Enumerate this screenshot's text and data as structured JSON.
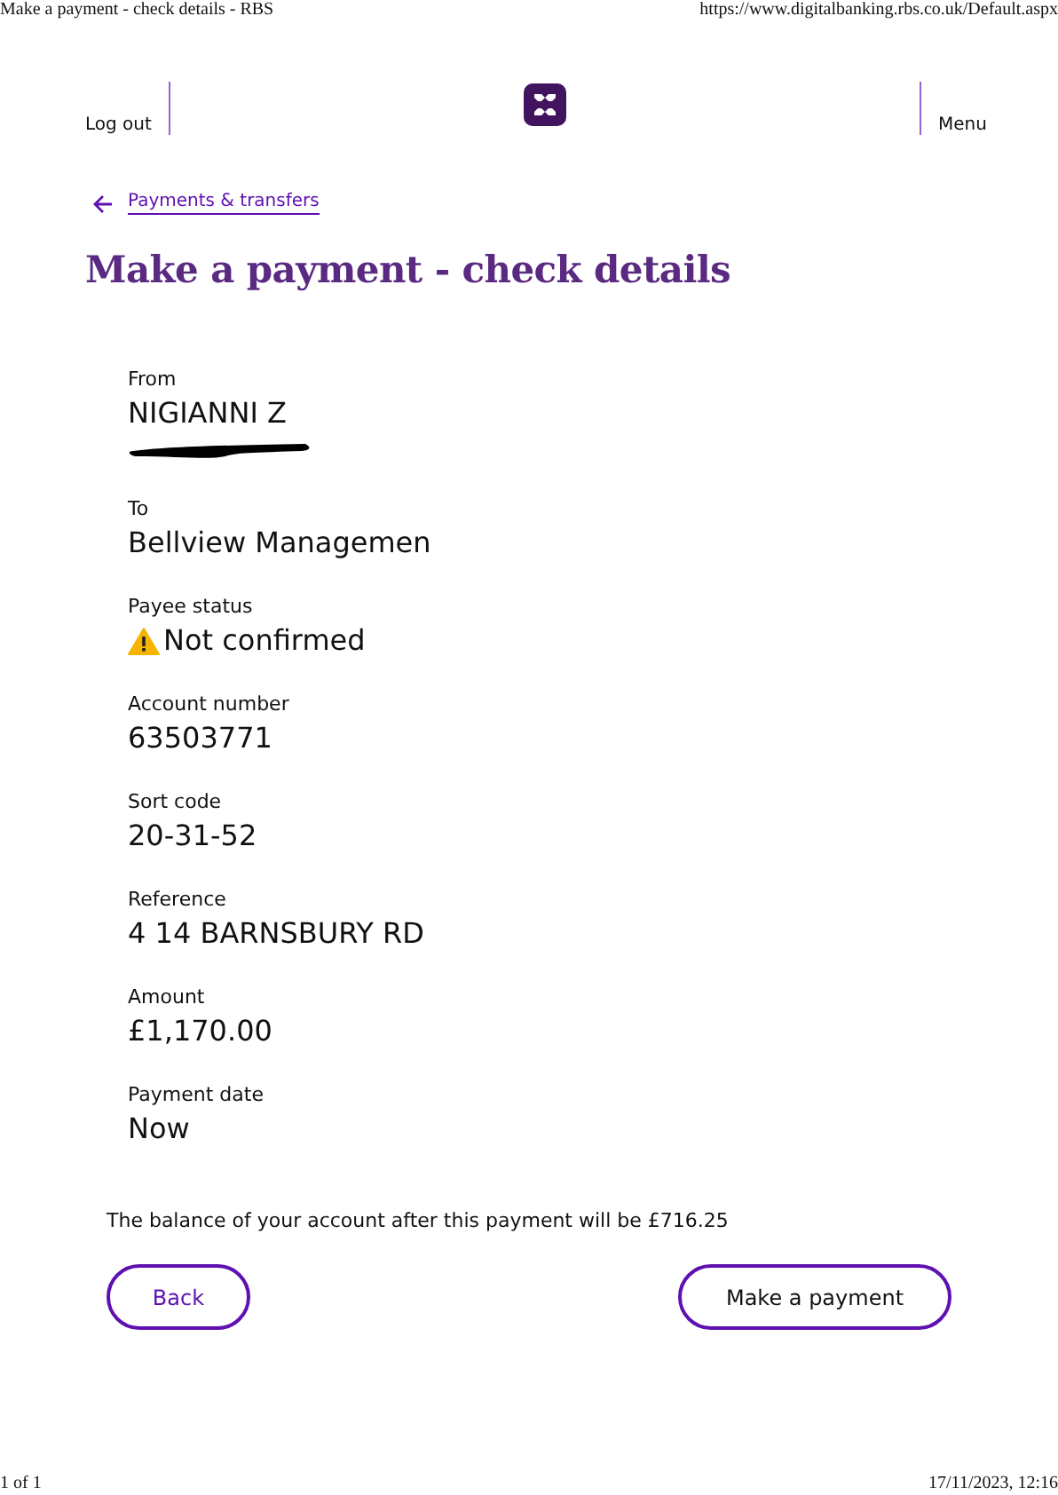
{
  "print_header": {
    "title": "Make a payment - check details - RBS",
    "url": "https://www.digitalbanking.rbs.co.uk/Default.aspx"
  },
  "nav": {
    "left": "Log out",
    "right": "Menu"
  },
  "breadcrumb": "Payments & transfers",
  "heading": "Make a payment - check details",
  "fields": [
    {
      "kind": "text",
      "label": "From",
      "value": "NIGIANNI Z",
      "redacted": true
    },
    {
      "kind": "text",
      "label": "To",
      "value": "Bellview Managemen",
      "redacted": false
    },
    {
      "kind": "status",
      "label": "Payee status",
      "value": "Not confirmed",
      "redacted": false
    },
    {
      "kind": "text",
      "label": "Account number",
      "value": "63503771",
      "redacted": false
    },
    {
      "kind": "text",
      "label": "Sort code",
      "value": "20-31-52",
      "redacted": false
    },
    {
      "kind": "text",
      "label": "Reference",
      "value": "4 14 BARNSBURY RD",
      "redacted": false
    },
    {
      "kind": "text",
      "label": "Amount",
      "value": "£1,170.00",
      "redacted": false
    },
    {
      "kind": "text",
      "label": "Payment date",
      "value": "Now",
      "redacted": false
    }
  ],
  "balance_note": "The balance of your account after this payment will be £716.25",
  "buttons": {
    "back": "Back",
    "submit": "Make a payment"
  },
  "print_footer": {
    "page": "1 of 1",
    "timestamp": "17/11/2023, 12:16"
  }
}
